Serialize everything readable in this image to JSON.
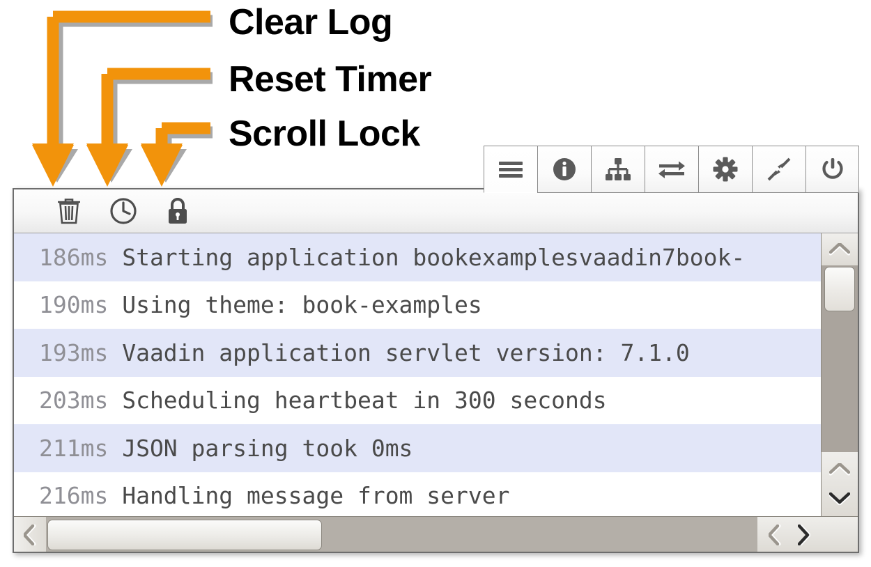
{
  "annotations": [
    {
      "id": "clear-log",
      "label": "Clear Log"
    },
    {
      "id": "reset-timer",
      "label": "Reset Timer"
    },
    {
      "id": "scroll-lock",
      "label": "Scroll Lock"
    }
  ],
  "colors": {
    "arrow": "#F2930B",
    "arrow_shadow": "#A9A9A9",
    "row_odd": "#E2E6F8",
    "row_even": "#FFFFFF",
    "timestamp_text": "#8F8F95",
    "message_text": "#4A4A4A",
    "panel_border": "#6D6D6D",
    "scrollbar_track": "#AAA49D"
  },
  "tabs": [
    {
      "name": "log",
      "icon": "hamburger-menu-icon",
      "active": true
    },
    {
      "name": "info",
      "icon": "info-circle-icon",
      "active": false
    },
    {
      "name": "hierarchy",
      "icon": "sitemap-icon",
      "active": false
    },
    {
      "name": "transfer",
      "icon": "transfer-arrows-icon",
      "active": false
    },
    {
      "name": "settings",
      "icon": "gear-icon",
      "active": false
    },
    {
      "name": "minimize",
      "icon": "collapse-arrows-icon",
      "active": false
    },
    {
      "name": "power",
      "icon": "power-icon",
      "active": false
    }
  ],
  "toolbar": {
    "clear_log": {
      "icon": "trash-icon",
      "title": "Clear Log"
    },
    "reset_timer": {
      "icon": "clock-icon",
      "title": "Reset Timer"
    },
    "scroll_lock": {
      "icon": "lock-icon",
      "title": "Scroll Lock"
    }
  },
  "log": {
    "rows": [
      {
        "time": "186ms",
        "message": "Starting application bookexamplesvaadin7book-"
      },
      {
        "time": "190ms",
        "message": "Using theme: book-examples"
      },
      {
        "time": "193ms",
        "message": "Vaadin application servlet version: 7.1.0"
      },
      {
        "time": "203ms",
        "message": "Scheduling heartbeat in 300 seconds"
      },
      {
        "time": "211ms",
        "message": "JSON parsing took 0ms"
      },
      {
        "time": "216ms",
        "message": "Handling message from server"
      }
    ]
  },
  "scrollbars": {
    "vertical": {
      "up_icon": "chevron-up-icon",
      "down_icon": "chevron-down-icon"
    },
    "horizontal": {
      "left_icon": "chevron-left-icon",
      "right_icon": "chevron-right-icon"
    }
  }
}
